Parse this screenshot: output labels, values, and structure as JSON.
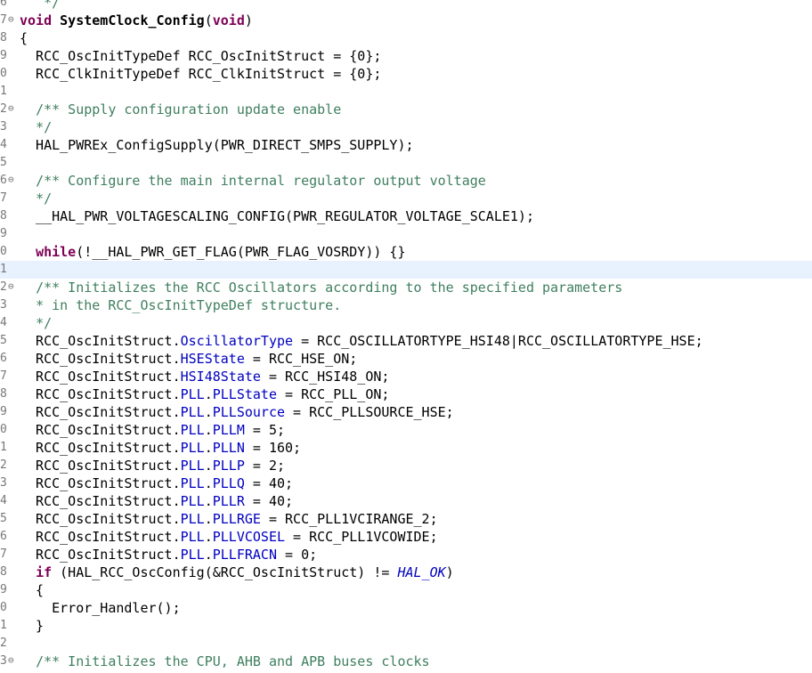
{
  "lines": [
    {
      "num": "6",
      "fold": "",
      "segs": [
        {
          "t": "   */",
          "c": "cm"
        }
      ]
    },
    {
      "num": "7",
      "fold": "⊖",
      "segs": [
        {
          "t": "void",
          "c": "kw"
        },
        {
          "t": " "
        },
        {
          "t": "SystemClock_Config",
          "c": "fn"
        },
        {
          "t": "("
        },
        {
          "t": "void",
          "c": "kw"
        },
        {
          "t": ")"
        }
      ]
    },
    {
      "num": "8",
      "fold": "",
      "segs": [
        {
          "t": "{"
        }
      ]
    },
    {
      "num": "9",
      "fold": "",
      "segs": [
        {
          "t": "  RCC_OscInitTypeDef RCC_OscInitStruct = {0};"
        }
      ]
    },
    {
      "num": "0",
      "fold": "",
      "segs": [
        {
          "t": "  RCC_ClkInitTypeDef RCC_ClkInitStruct = {0};"
        }
      ]
    },
    {
      "num": "1",
      "fold": "",
      "segs": []
    },
    {
      "num": "2",
      "fold": "⊖",
      "segs": [
        {
          "t": "  "
        },
        {
          "t": "/** Supply configuration update enable",
          "c": "cm"
        }
      ]
    },
    {
      "num": "3",
      "fold": "",
      "segs": [
        {
          "t": "  "
        },
        {
          "t": "*/",
          "c": "cm"
        }
      ]
    },
    {
      "num": "4",
      "fold": "",
      "segs": [
        {
          "t": "  HAL_PWREx_ConfigSupply(PWR_DIRECT_SMPS_SUPPLY);"
        }
      ]
    },
    {
      "num": "5",
      "fold": "",
      "segs": []
    },
    {
      "num": "6",
      "fold": "⊖",
      "segs": [
        {
          "t": "  "
        },
        {
          "t": "/** Configure the main internal regulator output voltage",
          "c": "cm"
        }
      ]
    },
    {
      "num": "7",
      "fold": "",
      "segs": [
        {
          "t": "  "
        },
        {
          "t": "*/",
          "c": "cm"
        }
      ]
    },
    {
      "num": "8",
      "fold": "",
      "segs": [
        {
          "t": "  __HAL_PWR_VOLTAGESCALING_CONFIG(PWR_REGULATOR_VOLTAGE_SCALE1);"
        }
      ]
    },
    {
      "num": "9",
      "fold": "",
      "segs": []
    },
    {
      "num": "0",
      "fold": "",
      "segs": [
        {
          "t": "  "
        },
        {
          "t": "while",
          "c": "kw"
        },
        {
          "t": "(!__HAL_PWR_GET_FLAG(PWR_FLAG_VOSRDY)) {}"
        }
      ]
    },
    {
      "num": "1",
      "fold": "",
      "current": true,
      "segs": []
    },
    {
      "num": "2",
      "fold": "⊖",
      "segs": [
        {
          "t": "  "
        },
        {
          "t": "/** Initializes the RCC Oscillators according to the specified parameters",
          "c": "cm"
        }
      ]
    },
    {
      "num": "3",
      "fold": "",
      "segs": [
        {
          "t": "  "
        },
        {
          "t": "* in the RCC_OscInitTypeDef structure.",
          "c": "cm"
        }
      ]
    },
    {
      "num": "4",
      "fold": "",
      "segs": [
        {
          "t": "  "
        },
        {
          "t": "*/",
          "c": "cm"
        }
      ]
    },
    {
      "num": "5",
      "fold": "",
      "segs": [
        {
          "t": "  RCC_OscInitStruct."
        },
        {
          "t": "OscillatorType",
          "c": "fld"
        },
        {
          "t": " = RCC_OSCILLATORTYPE_HSI48|RCC_OSCILLATORTYPE_HSE;"
        }
      ]
    },
    {
      "num": "6",
      "fold": "",
      "segs": [
        {
          "t": "  RCC_OscInitStruct."
        },
        {
          "t": "HSEState",
          "c": "fld"
        },
        {
          "t": " = RCC_HSE_ON;"
        }
      ]
    },
    {
      "num": "7",
      "fold": "",
      "segs": [
        {
          "t": "  RCC_OscInitStruct."
        },
        {
          "t": "HSI48State",
          "c": "fld"
        },
        {
          "t": " = RCC_HSI48_ON;"
        }
      ]
    },
    {
      "num": "8",
      "fold": "",
      "segs": [
        {
          "t": "  RCC_OscInitStruct."
        },
        {
          "t": "PLL",
          "c": "fld"
        },
        {
          "t": "."
        },
        {
          "t": "PLLState",
          "c": "fld"
        },
        {
          "t": " = RCC_PLL_ON;"
        }
      ]
    },
    {
      "num": "9",
      "fold": "",
      "segs": [
        {
          "t": "  RCC_OscInitStruct."
        },
        {
          "t": "PLL",
          "c": "fld"
        },
        {
          "t": "."
        },
        {
          "t": "PLLSource",
          "c": "fld"
        },
        {
          "t": " = RCC_PLLSOURCE_HSE;"
        }
      ]
    },
    {
      "num": "0",
      "fold": "",
      "segs": [
        {
          "t": "  RCC_OscInitStruct."
        },
        {
          "t": "PLL",
          "c": "fld"
        },
        {
          "t": "."
        },
        {
          "t": "PLLM",
          "c": "fld"
        },
        {
          "t": " = 5;"
        }
      ]
    },
    {
      "num": "1",
      "fold": "",
      "segs": [
        {
          "t": "  RCC_OscInitStruct."
        },
        {
          "t": "PLL",
          "c": "fld"
        },
        {
          "t": "."
        },
        {
          "t": "PLLN",
          "c": "fld"
        },
        {
          "t": " = 160;"
        }
      ]
    },
    {
      "num": "2",
      "fold": "",
      "segs": [
        {
          "t": "  RCC_OscInitStruct."
        },
        {
          "t": "PLL",
          "c": "fld"
        },
        {
          "t": "."
        },
        {
          "t": "PLLP",
          "c": "fld"
        },
        {
          "t": " = 2;"
        }
      ]
    },
    {
      "num": "3",
      "fold": "",
      "segs": [
        {
          "t": "  RCC_OscInitStruct."
        },
        {
          "t": "PLL",
          "c": "fld"
        },
        {
          "t": "."
        },
        {
          "t": "PLLQ",
          "c": "fld"
        },
        {
          "t": " = 40;"
        }
      ]
    },
    {
      "num": "4",
      "fold": "",
      "segs": [
        {
          "t": "  RCC_OscInitStruct."
        },
        {
          "t": "PLL",
          "c": "fld"
        },
        {
          "t": "."
        },
        {
          "t": "PLLR",
          "c": "fld"
        },
        {
          "t": " = 40;"
        }
      ]
    },
    {
      "num": "5",
      "fold": "",
      "segs": [
        {
          "t": "  RCC_OscInitStruct."
        },
        {
          "t": "PLL",
          "c": "fld"
        },
        {
          "t": "."
        },
        {
          "t": "PLLRGE",
          "c": "fld"
        },
        {
          "t": " = RCC_PLL1VCIRANGE_2;"
        }
      ]
    },
    {
      "num": "6",
      "fold": "",
      "segs": [
        {
          "t": "  RCC_OscInitStruct."
        },
        {
          "t": "PLL",
          "c": "fld"
        },
        {
          "t": "."
        },
        {
          "t": "PLLVCOSEL",
          "c": "fld"
        },
        {
          "t": " = RCC_PLL1VCOWIDE;"
        }
      ]
    },
    {
      "num": "7",
      "fold": "",
      "segs": [
        {
          "t": "  RCC_OscInitStruct."
        },
        {
          "t": "PLL",
          "c": "fld"
        },
        {
          "t": "."
        },
        {
          "t": "PLLFRACN",
          "c": "fld"
        },
        {
          "t": " = 0;"
        }
      ]
    },
    {
      "num": "8",
      "fold": "",
      "segs": [
        {
          "t": "  "
        },
        {
          "t": "if",
          "c": "kw"
        },
        {
          "t": " (HAL_RCC_OscConfig(&RCC_OscInitStruct) != "
        },
        {
          "t": "HAL_OK",
          "c": "en"
        },
        {
          "t": ")"
        }
      ]
    },
    {
      "num": "9",
      "fold": "",
      "segs": [
        {
          "t": "  {"
        }
      ]
    },
    {
      "num": "0",
      "fold": "",
      "segs": [
        {
          "t": "    Error_Handler();"
        }
      ]
    },
    {
      "num": "1",
      "fold": "",
      "segs": [
        {
          "t": "  }"
        }
      ]
    },
    {
      "num": "2",
      "fold": "",
      "segs": []
    },
    {
      "num": "3",
      "fold": "⊖",
      "segs": [
        {
          "t": "  "
        },
        {
          "t": "/** Initializes the CPU, AHB and APB buses clocks",
          "c": "cm"
        }
      ]
    }
  ]
}
